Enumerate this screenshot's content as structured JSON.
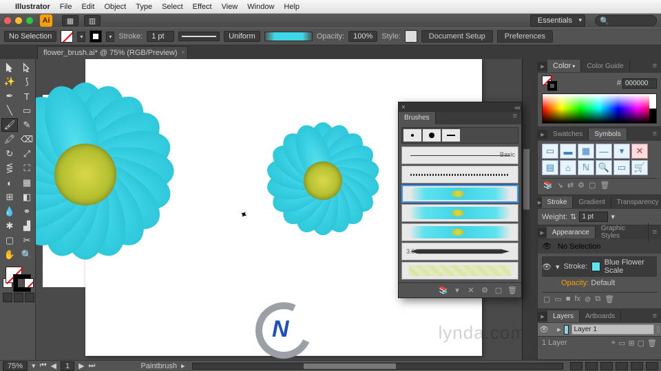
{
  "mac_menu": {
    "apple": "",
    "app": "Illustrator",
    "items": [
      "File",
      "Edit",
      "Object",
      "Type",
      "Select",
      "Effect",
      "View",
      "Window",
      "Help"
    ]
  },
  "titlebar": {
    "workspace": "Essentials",
    "search_placeholder": ""
  },
  "control": {
    "selection": "No Selection",
    "stroke_label": "Stroke:",
    "stroke_weight": "1 pt",
    "stroke_dash": "Uniform",
    "opacity_label": "Opacity:",
    "opacity": "100%",
    "style_label": "Style:",
    "doc_setup": "Document Setup",
    "prefs": "Preferences"
  },
  "doc_tab": "flower_brush.ai* @ 75% (RGB/Preview)",
  "panels": {
    "color": {
      "tabs": [
        "Color",
        "Color Guide"
      ],
      "hex_prefix": "#",
      "hex": "000000"
    },
    "symbols": {
      "tabs": [
        "Swatches",
        "Symbols"
      ]
    },
    "stroke": {
      "tabs": [
        "Stroke",
        "Gradient",
        "Transparency"
      ],
      "weight_label": "Weight:",
      "weight": "1 pt"
    },
    "appearance": {
      "tabs": [
        "Appearance",
        "Graphic Styles"
      ],
      "no_selection": "No Selection",
      "stroke_row": "Stroke:",
      "stroke_name": "Blue Flower Scale",
      "opacity_row": "Opacity:",
      "opacity_val": "Default"
    },
    "layers": {
      "tabs": [
        "Layers",
        "Artboards"
      ],
      "layer1": "Layer 1",
      "footer": "1 Layer"
    }
  },
  "brushes": {
    "title": "Brushes",
    "basic": "Basic",
    "callig_size": "3.00"
  },
  "status": {
    "zoom": "75%",
    "artboard_nav": "1",
    "tool": "Paintbrush"
  },
  "watermark": "lynda.com"
}
